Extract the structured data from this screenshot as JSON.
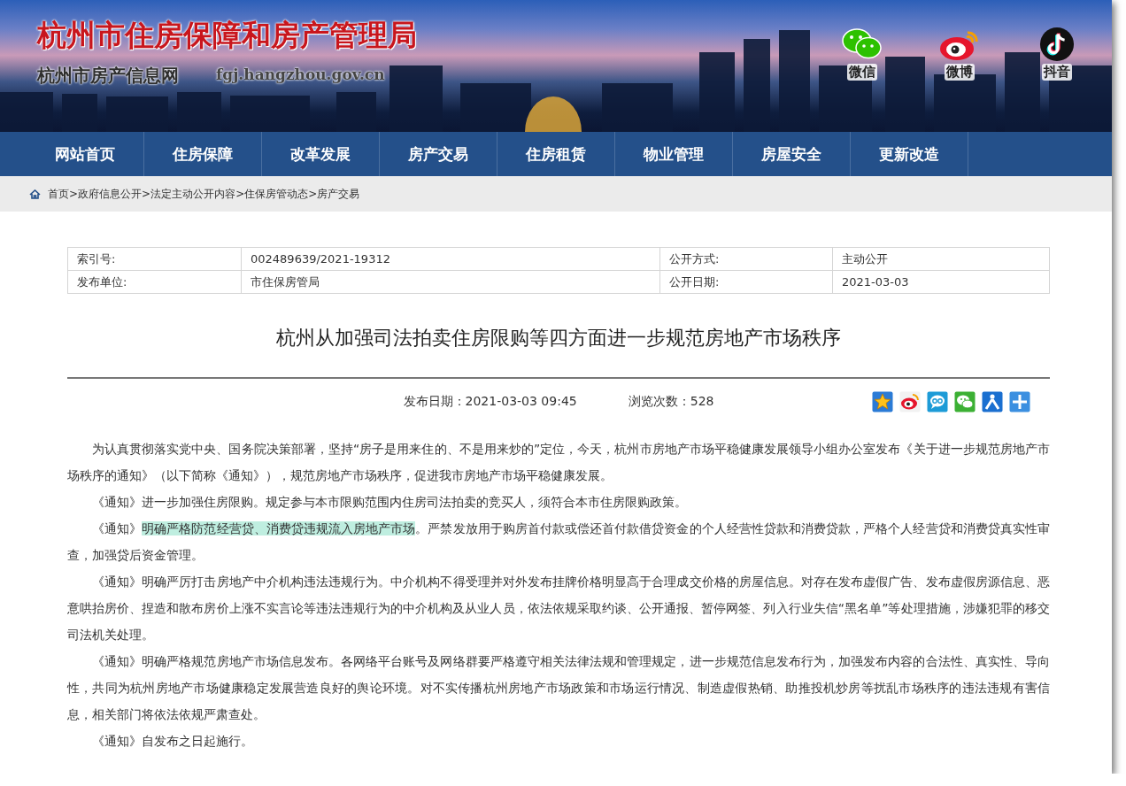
{
  "site": {
    "title": "杭州市住房保障和房产管理局",
    "subtitle": "杭州市房产信息网",
    "domain": "fgj.hangzhou.gov.cn",
    "social": [
      {
        "kind": "wechat",
        "label": "微信"
      },
      {
        "kind": "weibo",
        "label": "微博"
      },
      {
        "kind": "douyin",
        "label": "抖音"
      }
    ]
  },
  "nav": {
    "items": [
      "网站首页",
      "住房保障",
      "改革发展",
      "房产交易",
      "住房租赁",
      "物业管理",
      "房屋安全",
      "更新改造"
    ]
  },
  "breadcrumb": {
    "items": [
      {
        "label": "首页",
        "separator": ">"
      },
      {
        "label": "政府信息公开",
        "separator": ">"
      },
      {
        "label": "法定主动公开内容",
        "separator": ">"
      },
      {
        "label": "住保房管动态",
        "separator": ">"
      },
      {
        "label": "房产交易"
      }
    ]
  },
  "info_table": {
    "rows": [
      [
        {
          "label": "索引号:",
          "value": "002489639/2021-19312"
        },
        {
          "label": "公开方式:",
          "value": "主动公开"
        }
      ],
      [
        {
          "label": "发布单位:",
          "value": "市住保房管局"
        },
        {
          "label": "公开日期:",
          "value": "2021-03-03"
        }
      ]
    ]
  },
  "article": {
    "title": "杭州从加强司法拍卖住房限购等四方面进一步规范房地产市场秩序",
    "publish_date": "发布日期：2021-03-03 09:45",
    "views": "浏览次数：528",
    "share": [
      {
        "kind": "star"
      },
      {
        "kind": "weibo"
      },
      {
        "kind": "bubble"
      },
      {
        "kind": "wechat"
      },
      {
        "kind": "person"
      },
      {
        "kind": "plus"
      }
    ],
    "paragraphs": [
      {
        "segments": [
          {
            "text": "为认真贯彻落实党中央、国务院决策部署，坚持“房子是用来住的、不是用来炒的”定位，今天，杭州市房地产市场平稳健康发展领导小组办公室发布《关于进一步规范房地产市场秩序的通知》（以下简称《通知》），规范房地产市场秩序，促进我市房地产市场平稳健康发展。",
            "highlighted": false
          }
        ]
      },
      {
        "segments": [
          {
            "text": "《通知》进一步加强住房限购。规定参与本市限购范围内住房司法拍卖的竞买人，须符合本市住房限购政策。",
            "highlighted": false
          }
        ]
      },
      {
        "segments": [
          {
            "text": "《通知》",
            "highlighted": false
          },
          {
            "text": "明确严格防范经营贷、消费贷违规流入房地产市场",
            "highlighted": true
          },
          {
            "text": "。严禁发放用于购房首付款或偿还首付款借贷资金的个人经营性贷款和消费贷款，严格个人经营贷和消费贷真实性审查，加强贷后资金管理。",
            "highlighted": false
          }
        ]
      },
      {
        "segments": [
          {
            "text": "《通知》明确严厉打击房地产中介机构违法违规行为。中介机构不得受理并对外发布挂牌价格明显高于合理成交价格的房屋信息。对存在发布虚假广告、发布虚假房源信息、恶意哄抬房价、捏造和散布房价上涨不实言论等违法违规行为的中介机构及从业人员，依法依规采取约谈、公开通报、暂停网签、列入行业失信“黑名单”等处理措施，涉嫌犯罪的移交司法机关处理。",
            "highlighted": false
          }
        ]
      },
      {
        "segments": [
          {
            "text": "《通知》明确严格规范房地产市场信息发布。各网络平台账号及网络群要严格遵守相关法律法规和管理规定，进一步规范信息发布行为，加强发布内容的合法性、真实性、导向性，共同为杭州房地产市场健康稳定发展营造良好的舆论环境。对不实传播杭州房地产市场政策和市场运行情况、制造虚假热销、助推投机炒房等扰乱市场秩序的违法违规有害信息，相关部门将依法依规严肃查处。",
            "highlighted": false
          }
        ]
      },
      {
        "segments": [
          {
            "text": "《通知》自发布之日起施行。",
            "highlighted": false
          }
        ]
      }
    ]
  }
}
